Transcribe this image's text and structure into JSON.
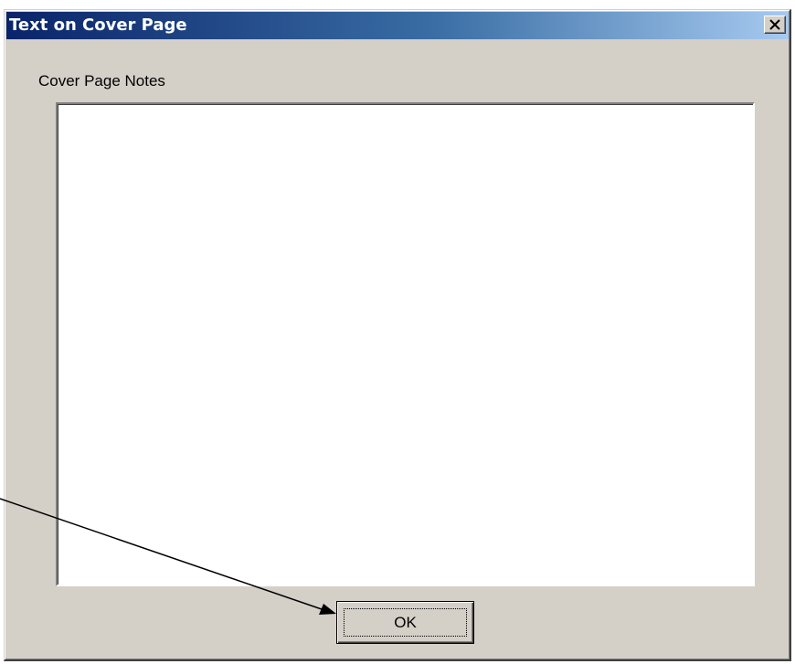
{
  "dialog": {
    "title": "Text on Cover Page",
    "close_label": "×",
    "notes_label": "Cover Page Notes",
    "notes_value": "",
    "ok_label": "OK"
  },
  "colors": {
    "title_bar_start": "#0a246a",
    "title_bar_end": "#a6caf0",
    "dialog_face": "#d4d0c8"
  },
  "icons": {
    "close": "close-icon",
    "annotation": "pointer-arrow-icon"
  }
}
